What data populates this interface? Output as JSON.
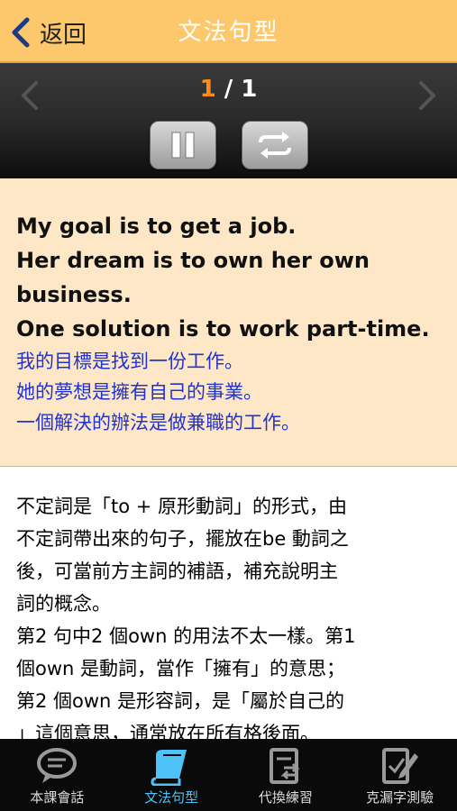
{
  "header": {
    "back_label": "返回",
    "title": "文法句型"
  },
  "player": {
    "current": "1",
    "separator": " / ",
    "total": "1"
  },
  "sentence": {
    "english": [
      "My goal is to get a job.",
      "Her dream is to own her own",
      "business.",
      "One solution is to work part-time."
    ],
    "chinese": [
      "我的目標是找到一份工作。",
      "她的夢想是擁有自己的事業。",
      "一個解決的辦法是做兼職的工作。"
    ]
  },
  "explanation": {
    "lines": [
      "不定詞是「to + 原形動詞」的形式，由",
      "不定詞帶出來的句子，擺放在be 動詞之",
      "後，可當前方主詞的補語，補充說明主",
      "詞的概念。",
      "第2 句中2 個own 的用法不太一樣。第1",
      "個own 是動詞，當作「擁有」的意思；",
      "第2 個own 是形容詞，是「屬於自己的",
      "」這個意思，通常放在所有格後面。"
    ]
  },
  "tabs": [
    {
      "label": "本課會話",
      "icon": "chat-bubble-icon",
      "active": false
    },
    {
      "label": "文法句型",
      "icon": "book-icon",
      "active": true
    },
    {
      "label": "代換練習",
      "icon": "document-swap-icon",
      "active": false
    },
    {
      "label": "克漏字測驗",
      "icon": "pencil-edit-icon",
      "active": false
    }
  ],
  "colors": {
    "header": "#fcc86b",
    "counter_current": "#ff8c1a",
    "chinese_text": "#2233cc",
    "tab_active": "#4fc3f7",
    "sentence_bg": "#fde7c6"
  }
}
